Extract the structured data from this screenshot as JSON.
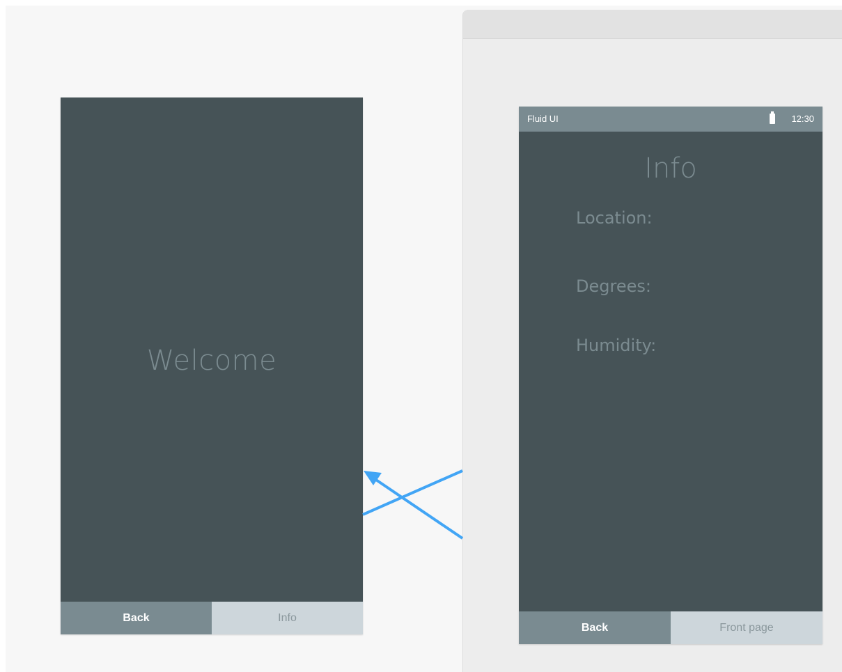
{
  "screens": {
    "welcome": {
      "title": "Welcome",
      "tabs": [
        {
          "label": "Back"
        },
        {
          "label": "Info"
        }
      ]
    },
    "info": {
      "status_bar": {
        "app_name": "Fluid UI",
        "battery_icon": "battery-icon",
        "time": "12:30"
      },
      "title": "Info",
      "fields": [
        {
          "label": "Location:"
        },
        {
          "label": "Degrees:"
        },
        {
          "label": "Humidity:"
        }
      ],
      "tabs": [
        {
          "label": "Back"
        },
        {
          "label": "Front page"
        }
      ]
    }
  },
  "colors": {
    "screen_bg": "#465357",
    "tab_dark": "#7a8b91",
    "tab_light": "#cdd6db",
    "text_muted": "#7b8b90",
    "link_arrow": "#42a5f5",
    "canvas_bg": "#f7f7f7",
    "panel_bg": "#ededed"
  }
}
